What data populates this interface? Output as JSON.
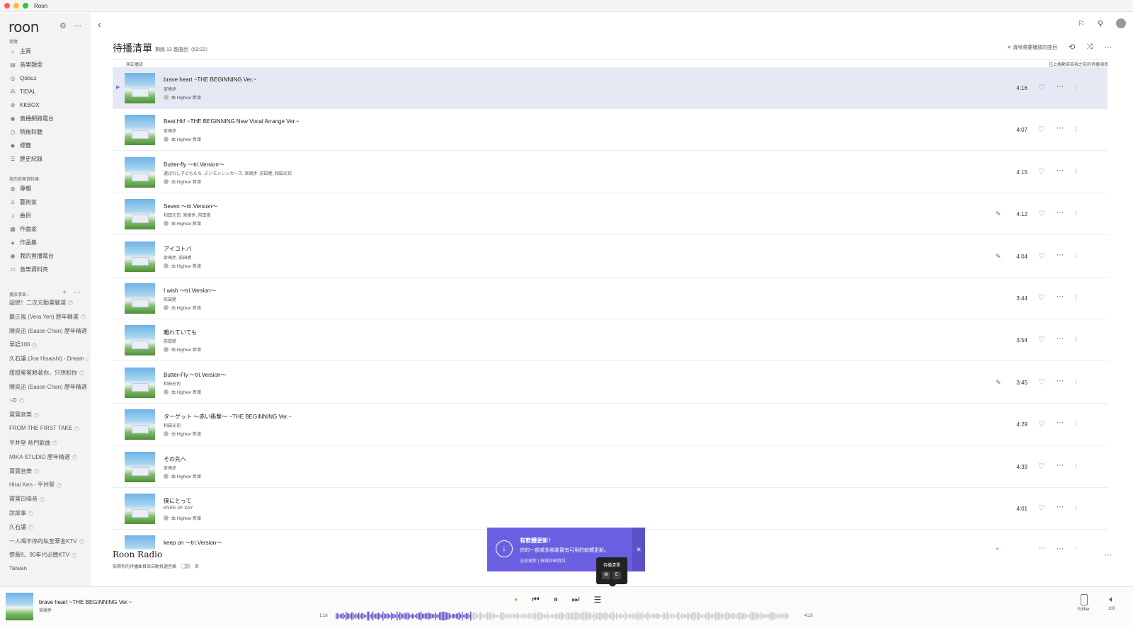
{
  "window": {
    "title": "Roon"
  },
  "sidebar": {
    "logo": "roon",
    "browse_section": "瀏覽",
    "browse": [
      {
        "label": "主頁",
        "icon": "⌂"
      },
      {
        "label": "音樂類型",
        "icon": "▤"
      },
      {
        "label": "Qobuz",
        "icon": "◎"
      },
      {
        "label": "TIDAL",
        "icon": "⁂"
      },
      {
        "label": "KKBOX",
        "icon": "⊗"
      },
      {
        "label": "直播網路電台",
        "icon": "◉"
      },
      {
        "label": "稍後聆聽",
        "icon": "◷"
      },
      {
        "label": "標籤",
        "icon": "◆"
      },
      {
        "label": "歷史紀錄",
        "icon": "☰"
      }
    ],
    "library_section": "我的音樂資料庫",
    "library": [
      {
        "label": "專輯",
        "icon": "◍"
      },
      {
        "label": "藝術家",
        "icon": "♙"
      },
      {
        "label": "曲目",
        "icon": "♫"
      },
      {
        "label": "作曲家",
        "icon": "▦"
      },
      {
        "label": "作品集",
        "icon": "▲"
      },
      {
        "label": "我的直播電台",
        "icon": "◉"
      },
      {
        "label": "音樂資料夾",
        "icon": "▭"
      }
    ],
    "playlists_section": "播放清單 ›",
    "playlists": [
      "超燃！二次元動畫嚴選",
      "嚴正嵐 (Vera Yen) 歷年精選",
      "陳奕迅 (Eason Chan) 歷年精選",
      "華語100",
      "久石讓 (Joe Hisaishi) - Dream",
      "甜甜蜜蜜賴著你，只想和你",
      "陳奕迅 (Eason Chan) 歷年精選",
      ":-D",
      "寶寶音樂",
      "FROM THE FIRST TAKE",
      "平井堅 熱門歌曲",
      "MIKA STUDIO 歷年精選",
      "寶寶音樂",
      "Hirai Ken - 平井堅",
      "寶寶白噪音",
      "說故事",
      "久石讓",
      "一人喝不停的私室華金KTV",
      "懷舊8、90年代必聽KTV",
      "Taiwan"
    ]
  },
  "header": {
    "title": "待播清單",
    "subtitle": "剩餘 13 首曲目（53:22）",
    "clear_label": "清除將要播放的曲目",
    "now_playing_label": "現正播放",
    "history_label": "往上捲動來檢視之前的待播項目"
  },
  "tracks": [
    {
      "title": "brave heart ~THE BEGINNING Ver.~",
      "artist": "宮崎步",
      "added": "由 Highker 新增",
      "duration": "4:16",
      "pinned": false,
      "current": true
    },
    {
      "title": "Beat Hit! ~THE BEGINNING New Vocal Arrange Ver.~",
      "artist": "宮崎步",
      "added": "由 Highker 新增",
      "duration": "4:07",
      "pinned": false,
      "current": false
    },
    {
      "title": "Butter-fly ～tri.Version～",
      "artist": "選ばれし子どもたち, デジモンシンカーズ, 宮崎步, 前田愛, 和田光司",
      "added": "由 Highker 新增",
      "duration": "4:15",
      "pinned": false,
      "current": false
    },
    {
      "title": "Seven ～tri.Version～",
      "artist": "和田光司, 宮崎步, 前田愛",
      "added": "由 Highker 新增",
      "duration": "4:12",
      "pinned": true,
      "current": false
    },
    {
      "title": "アイコトバ",
      "artist": "宮崎步, 前田愛",
      "added": "由 Highker 新增",
      "duration": "4:04",
      "pinned": true,
      "current": false
    },
    {
      "title": "I wish ～tri.Version～",
      "artist": "前田愛",
      "added": "由 Highker 新增",
      "duration": "3:44",
      "pinned": false,
      "current": false
    },
    {
      "title": "離れていても",
      "artist": "前田愛",
      "added": "由 Highker 新增",
      "duration": "3:54",
      "pinned": false,
      "current": false
    },
    {
      "title": "Butter-Fly ～tri.Version～",
      "artist": "和田光司",
      "added": "由 Highker 新增",
      "duration": "3:45",
      "pinned": true,
      "current": false
    },
    {
      "title": "ターゲット ～赤い衝撃～ ~THE BEGINNING Ver.~",
      "artist": "和田光司",
      "added": "由 Highker 新增",
      "duration": "4:29",
      "pinned": false,
      "current": false
    },
    {
      "title": "その先へ",
      "artist": "宮崎步",
      "added": "由 Highker 新增",
      "duration": "4:39",
      "pinned": false,
      "current": false
    },
    {
      "title": "僕にとって",
      "artist": "KNIFE OF DAY",
      "added": "由 Highker 新增",
      "duration": "4:01",
      "pinned": false,
      "current": false
    },
    {
      "title": "keep on ～tri.Version～",
      "artist": "",
      "added": "",
      "duration": "",
      "pinned": true,
      "current": false
    }
  ],
  "radio": {
    "title": "Roon Radio",
    "description": "依照你的待播曲目來自動挑選音樂",
    "toggle_state": "否"
  },
  "notification": {
    "title": "有軟體更新！",
    "text": "你的一部或多部裝置有可用的軟體更新。",
    "links": "全部更新 | 檢視詳細資訊"
  },
  "tooltip": {
    "label": "待播清單",
    "keys": [
      "⌘",
      "E"
    ]
  },
  "player": {
    "title": "brave heart ~THE BEGINNING Ver.~",
    "artist": "宮崎步",
    "elapsed": "1:16",
    "total": "4:16",
    "progress": 0.297,
    "zone": "Edifier",
    "volume": "100"
  },
  "colors": {
    "accent": "#6a5acd",
    "current_row": "#e6e9f4",
    "notification": "#6a5fe0"
  }
}
